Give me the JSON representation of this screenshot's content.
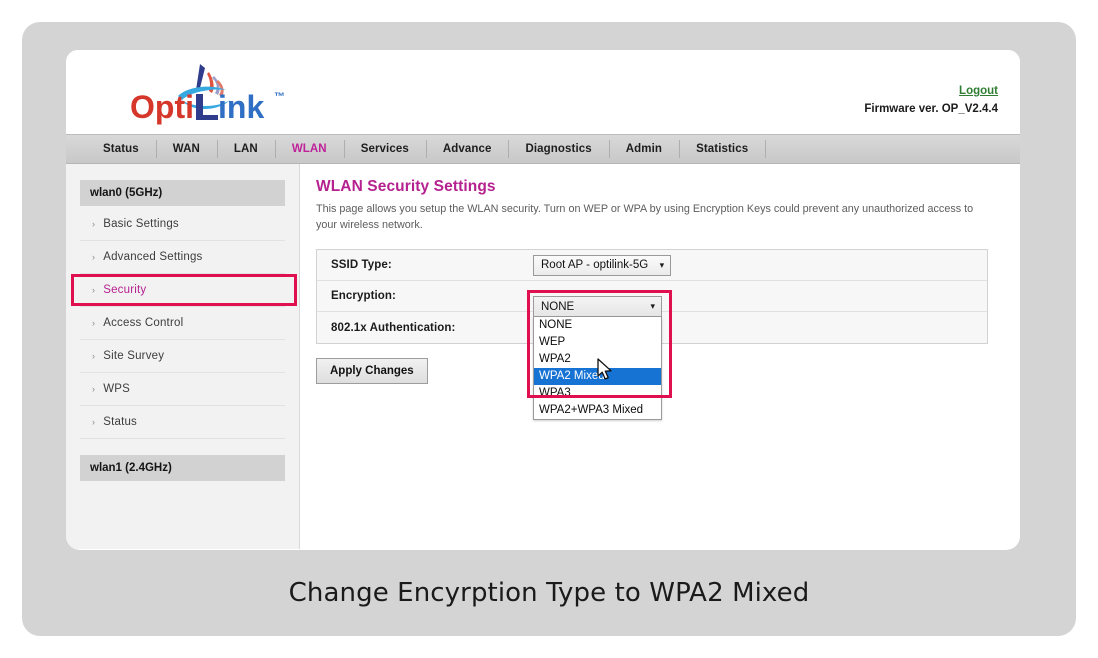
{
  "header": {
    "logo_text_primary": "Opti",
    "logo_text_secondary": "ink",
    "logo_trademark": "™",
    "logout_label": "Logout",
    "firmware_text": "Firmware ver. OP_V2.4.4",
    "logout_color": "#2f7d32"
  },
  "nav": {
    "tabs": [
      {
        "label": "Status",
        "active": false
      },
      {
        "label": "WAN",
        "active": false
      },
      {
        "label": "LAN",
        "active": false
      },
      {
        "label": "WLAN",
        "active": true
      },
      {
        "label": "Services",
        "active": false
      },
      {
        "label": "Advance",
        "active": false
      },
      {
        "label": "Diagnostics",
        "active": false
      },
      {
        "label": "Admin",
        "active": false
      },
      {
        "label": "Statistics",
        "active": false
      }
    ],
    "active_color": "#c0219a"
  },
  "sidebar": {
    "section_1": "wlan0 (5GHz)",
    "section_2": "wlan1 (2.4GHz)",
    "arrow_glyph": "›",
    "items": [
      {
        "label": "Basic Settings",
        "active": false
      },
      {
        "label": "Advanced Settings",
        "active": false
      },
      {
        "label": "Security",
        "active": true
      },
      {
        "label": "Access Control",
        "active": false
      },
      {
        "label": "Site Survey",
        "active": false
      },
      {
        "label": "WPS",
        "active": false
      },
      {
        "label": "Status",
        "active": false
      }
    ],
    "active_color": "#b5218f"
  },
  "content": {
    "title": "WLAN Security Settings",
    "description": "This page allows you setup the WLAN security. Turn on WEP or WPA by using Encryption Keys could prevent any unauthorized access to your wireless network.",
    "title_color": "#b5218f",
    "rows": [
      {
        "label": "SSID Type:",
        "value": "Root AP - optilink-5G"
      },
      {
        "label": "Encryption:",
        "value": "NONE"
      },
      {
        "label": "802.1x Authentication:",
        "value": ""
      }
    ],
    "chevron_glyph": "❯",
    "apply_button": "Apply Changes"
  },
  "dropdown": {
    "open": true,
    "selected": "WPA2 Mixed",
    "highlight_color": "#1673d4",
    "options": [
      "NONE",
      "WEP",
      "WPA2",
      "WPA2 Mixed",
      "WPA3",
      "WPA2+WPA3 Mixed"
    ]
  },
  "annotations": {
    "color": "#e01050",
    "security_box": "security-highlight",
    "encryption_box": "encryption-highlight"
  },
  "caption": {
    "text": "Change Encyrption Type to WPA2 Mixed"
  }
}
